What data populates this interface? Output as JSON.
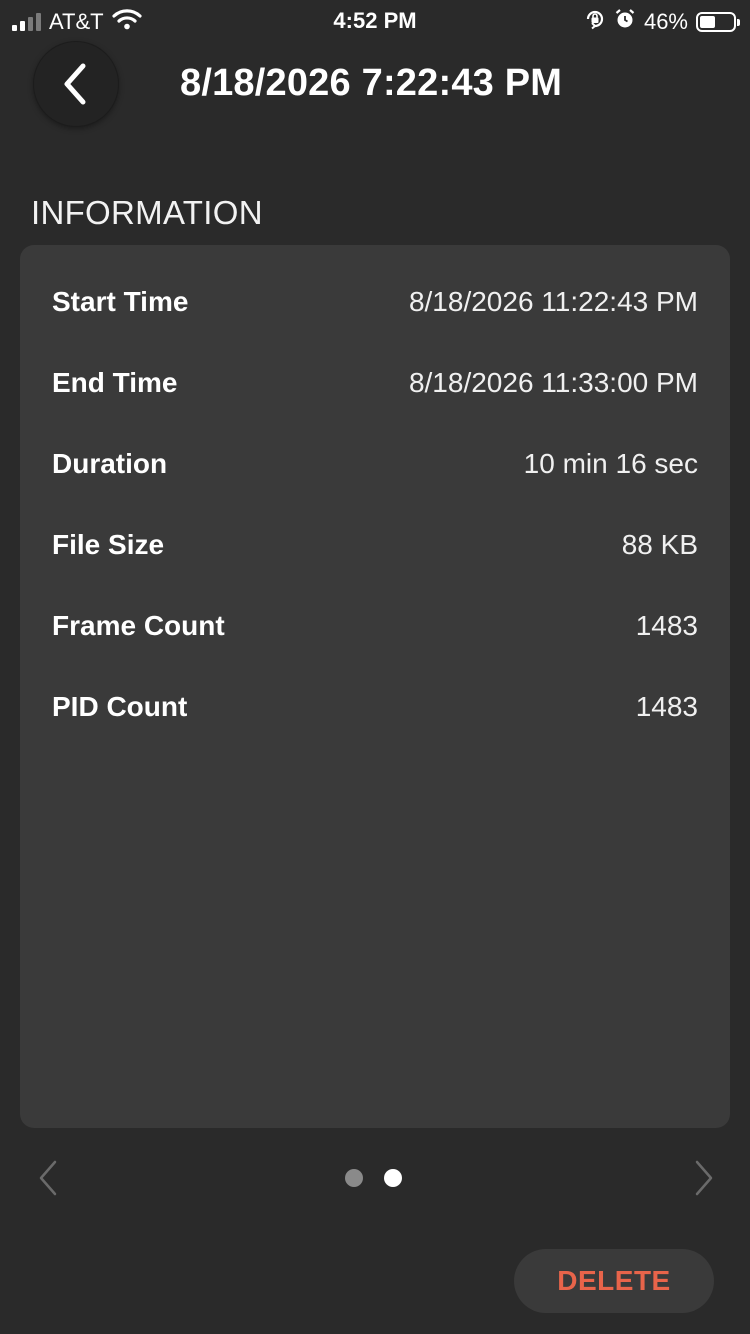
{
  "status_bar": {
    "carrier": "AT&T",
    "time": "4:52 PM",
    "battery_percent": "46%",
    "battery_level": 0.46,
    "icons": [
      "signal-icon",
      "wifi-icon",
      "orientation-lock-icon",
      "alarm-icon",
      "battery-icon"
    ]
  },
  "header": {
    "title": "8/18/2026 7:22:43 PM",
    "back_icon": "chevron-left-icon"
  },
  "section": {
    "title": "INFORMATION"
  },
  "info": {
    "rows": [
      {
        "label": "Start Time",
        "value": "8/18/2026 11:22:43 PM"
      },
      {
        "label": "End Time",
        "value": "8/18/2026 11:33:00 PM"
      },
      {
        "label": "Duration",
        "value": "10 min 16 sec"
      },
      {
        "label": "File Size",
        "value": "88 KB"
      },
      {
        "label": "Frame Count",
        "value": "1483"
      },
      {
        "label": "PID Count",
        "value": "1483"
      }
    ]
  },
  "pager": {
    "page_count": 2,
    "current_page": 2
  },
  "actions": {
    "delete_label": "DELETE"
  },
  "colors": {
    "background": "#2a2a2a",
    "card": "#3a3a3a",
    "delete_text": "#e8644a",
    "dot_active": "#ffffff",
    "dot_inactive": "#8a8a8a"
  }
}
